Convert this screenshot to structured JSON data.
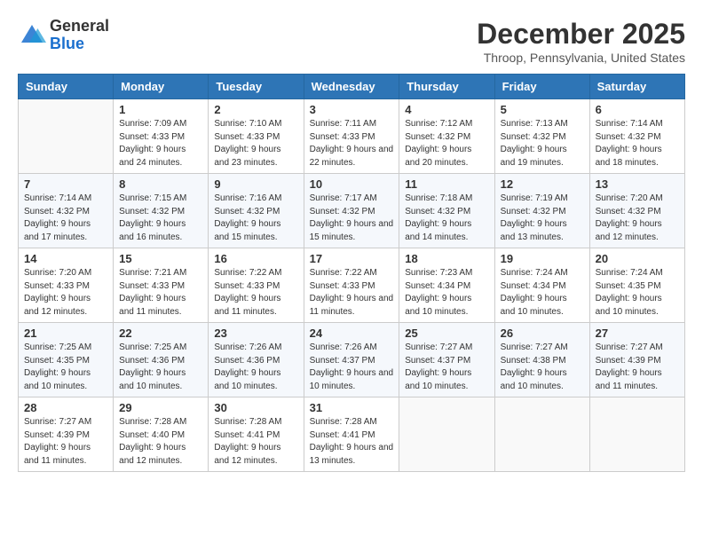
{
  "header": {
    "logo_general": "General",
    "logo_blue": "Blue",
    "month_title": "December 2025",
    "location": "Throop, Pennsylvania, United States"
  },
  "weekdays": [
    "Sunday",
    "Monday",
    "Tuesday",
    "Wednesday",
    "Thursday",
    "Friday",
    "Saturday"
  ],
  "weeks": [
    [
      {
        "day": "",
        "sunrise": "",
        "sunset": "",
        "daylight": ""
      },
      {
        "day": "1",
        "sunrise": "Sunrise: 7:09 AM",
        "sunset": "Sunset: 4:33 PM",
        "daylight": "Daylight: 9 hours and 24 minutes."
      },
      {
        "day": "2",
        "sunrise": "Sunrise: 7:10 AM",
        "sunset": "Sunset: 4:33 PM",
        "daylight": "Daylight: 9 hours and 23 minutes."
      },
      {
        "day": "3",
        "sunrise": "Sunrise: 7:11 AM",
        "sunset": "Sunset: 4:33 PM",
        "daylight": "Daylight: 9 hours and 22 minutes."
      },
      {
        "day": "4",
        "sunrise": "Sunrise: 7:12 AM",
        "sunset": "Sunset: 4:32 PM",
        "daylight": "Daylight: 9 hours and 20 minutes."
      },
      {
        "day": "5",
        "sunrise": "Sunrise: 7:13 AM",
        "sunset": "Sunset: 4:32 PM",
        "daylight": "Daylight: 9 hours and 19 minutes."
      },
      {
        "day": "6",
        "sunrise": "Sunrise: 7:14 AM",
        "sunset": "Sunset: 4:32 PM",
        "daylight": "Daylight: 9 hours and 18 minutes."
      }
    ],
    [
      {
        "day": "7",
        "sunrise": "Sunrise: 7:14 AM",
        "sunset": "Sunset: 4:32 PM",
        "daylight": "Daylight: 9 hours and 17 minutes."
      },
      {
        "day": "8",
        "sunrise": "Sunrise: 7:15 AM",
        "sunset": "Sunset: 4:32 PM",
        "daylight": "Daylight: 9 hours and 16 minutes."
      },
      {
        "day": "9",
        "sunrise": "Sunrise: 7:16 AM",
        "sunset": "Sunset: 4:32 PM",
        "daylight": "Daylight: 9 hours and 15 minutes."
      },
      {
        "day": "10",
        "sunrise": "Sunrise: 7:17 AM",
        "sunset": "Sunset: 4:32 PM",
        "daylight": "Daylight: 9 hours and 15 minutes."
      },
      {
        "day": "11",
        "sunrise": "Sunrise: 7:18 AM",
        "sunset": "Sunset: 4:32 PM",
        "daylight": "Daylight: 9 hours and 14 minutes."
      },
      {
        "day": "12",
        "sunrise": "Sunrise: 7:19 AM",
        "sunset": "Sunset: 4:32 PM",
        "daylight": "Daylight: 9 hours and 13 minutes."
      },
      {
        "day": "13",
        "sunrise": "Sunrise: 7:20 AM",
        "sunset": "Sunset: 4:32 PM",
        "daylight": "Daylight: 9 hours and 12 minutes."
      }
    ],
    [
      {
        "day": "14",
        "sunrise": "Sunrise: 7:20 AM",
        "sunset": "Sunset: 4:33 PM",
        "daylight": "Daylight: 9 hours and 12 minutes."
      },
      {
        "day": "15",
        "sunrise": "Sunrise: 7:21 AM",
        "sunset": "Sunset: 4:33 PM",
        "daylight": "Daylight: 9 hours and 11 minutes."
      },
      {
        "day": "16",
        "sunrise": "Sunrise: 7:22 AM",
        "sunset": "Sunset: 4:33 PM",
        "daylight": "Daylight: 9 hours and 11 minutes."
      },
      {
        "day": "17",
        "sunrise": "Sunrise: 7:22 AM",
        "sunset": "Sunset: 4:33 PM",
        "daylight": "Daylight: 9 hours and 11 minutes."
      },
      {
        "day": "18",
        "sunrise": "Sunrise: 7:23 AM",
        "sunset": "Sunset: 4:34 PM",
        "daylight": "Daylight: 9 hours and 10 minutes."
      },
      {
        "day": "19",
        "sunrise": "Sunrise: 7:24 AM",
        "sunset": "Sunset: 4:34 PM",
        "daylight": "Daylight: 9 hours and 10 minutes."
      },
      {
        "day": "20",
        "sunrise": "Sunrise: 7:24 AM",
        "sunset": "Sunset: 4:35 PM",
        "daylight": "Daylight: 9 hours and 10 minutes."
      }
    ],
    [
      {
        "day": "21",
        "sunrise": "Sunrise: 7:25 AM",
        "sunset": "Sunset: 4:35 PM",
        "daylight": "Daylight: 9 hours and 10 minutes."
      },
      {
        "day": "22",
        "sunrise": "Sunrise: 7:25 AM",
        "sunset": "Sunset: 4:36 PM",
        "daylight": "Daylight: 9 hours and 10 minutes."
      },
      {
        "day": "23",
        "sunrise": "Sunrise: 7:26 AM",
        "sunset": "Sunset: 4:36 PM",
        "daylight": "Daylight: 9 hours and 10 minutes."
      },
      {
        "day": "24",
        "sunrise": "Sunrise: 7:26 AM",
        "sunset": "Sunset: 4:37 PM",
        "daylight": "Daylight: 9 hours and 10 minutes."
      },
      {
        "day": "25",
        "sunrise": "Sunrise: 7:27 AM",
        "sunset": "Sunset: 4:37 PM",
        "daylight": "Daylight: 9 hours and 10 minutes."
      },
      {
        "day": "26",
        "sunrise": "Sunrise: 7:27 AM",
        "sunset": "Sunset: 4:38 PM",
        "daylight": "Daylight: 9 hours and 10 minutes."
      },
      {
        "day": "27",
        "sunrise": "Sunrise: 7:27 AM",
        "sunset": "Sunset: 4:39 PM",
        "daylight": "Daylight: 9 hours and 11 minutes."
      }
    ],
    [
      {
        "day": "28",
        "sunrise": "Sunrise: 7:27 AM",
        "sunset": "Sunset: 4:39 PM",
        "daylight": "Daylight: 9 hours and 11 minutes."
      },
      {
        "day": "29",
        "sunrise": "Sunrise: 7:28 AM",
        "sunset": "Sunset: 4:40 PM",
        "daylight": "Daylight: 9 hours and 12 minutes."
      },
      {
        "day": "30",
        "sunrise": "Sunrise: 7:28 AM",
        "sunset": "Sunset: 4:41 PM",
        "daylight": "Daylight: 9 hours and 12 minutes."
      },
      {
        "day": "31",
        "sunrise": "Sunrise: 7:28 AM",
        "sunset": "Sunset: 4:41 PM",
        "daylight": "Daylight: 9 hours and 13 minutes."
      },
      {
        "day": "",
        "sunrise": "",
        "sunset": "",
        "daylight": ""
      },
      {
        "day": "",
        "sunrise": "",
        "sunset": "",
        "daylight": ""
      },
      {
        "day": "",
        "sunrise": "",
        "sunset": "",
        "daylight": ""
      }
    ]
  ]
}
